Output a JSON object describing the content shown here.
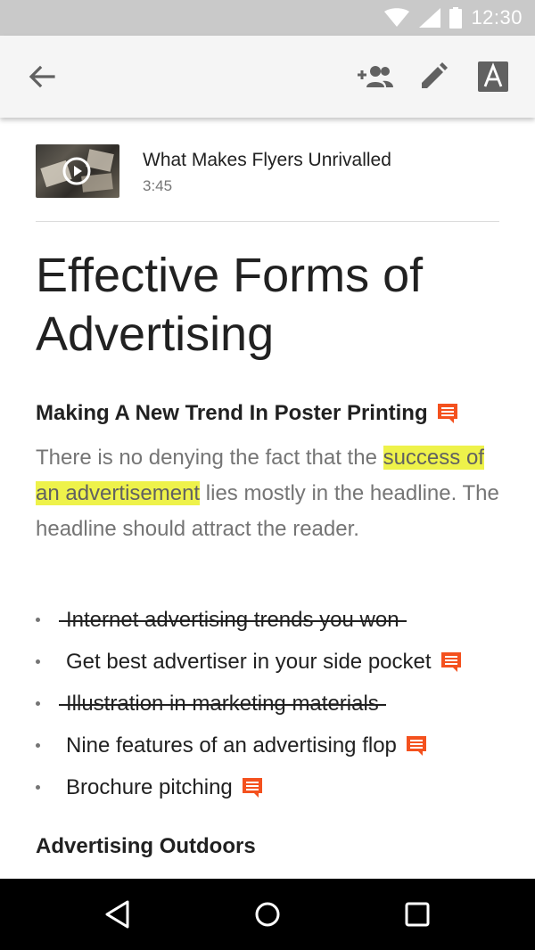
{
  "status_bar": {
    "time": "12:30",
    "icons": [
      "wifi-icon",
      "cell-signal-icon",
      "battery-icon"
    ]
  },
  "app_bar": {
    "actions": [
      "back-arrow-icon",
      "add-people-icon",
      "edit-pencil-icon",
      "text-format-icon"
    ]
  },
  "video": {
    "title": "What Makes Flyers Unrivalled",
    "duration": "3:45",
    "icon": "play-icon"
  },
  "document": {
    "title": "Effective Forms of Advertising",
    "section1": {
      "heading": "Making A New Trend In Poster Printing",
      "paragraph": {
        "before": "There is no denying the fact that the ",
        "highlight": "success of an advertisement",
        "after": " lies mostly in the headline. The headline should attract the reader."
      }
    },
    "bullets": [
      {
        "text": "Internet advertising trends you won",
        "strikethrough": true,
        "comment": false
      },
      {
        "text": "Get best advertiser in your side pocket",
        "strikethrough": false,
        "comment": true
      },
      {
        "text": "Illustration in marketing materials",
        "strikethrough": true,
        "comment": false
      },
      {
        "text": "Nine features of an advertising flop",
        "strikethrough": false,
        "comment": true
      },
      {
        "text": "Brochure pitching",
        "strikethrough": false,
        "comment": true
      }
    ],
    "section2": {
      "heading": "Advertising Outdoors"
    }
  },
  "colors": {
    "accent_comment": "#f4511e",
    "highlight": "#eef24a",
    "status_bar": "#c9c9c9",
    "app_bar": "#f5f5f5"
  },
  "nav_bar": {
    "icons": [
      "nav-back-icon",
      "nav-home-icon",
      "nav-recents-icon"
    ]
  }
}
